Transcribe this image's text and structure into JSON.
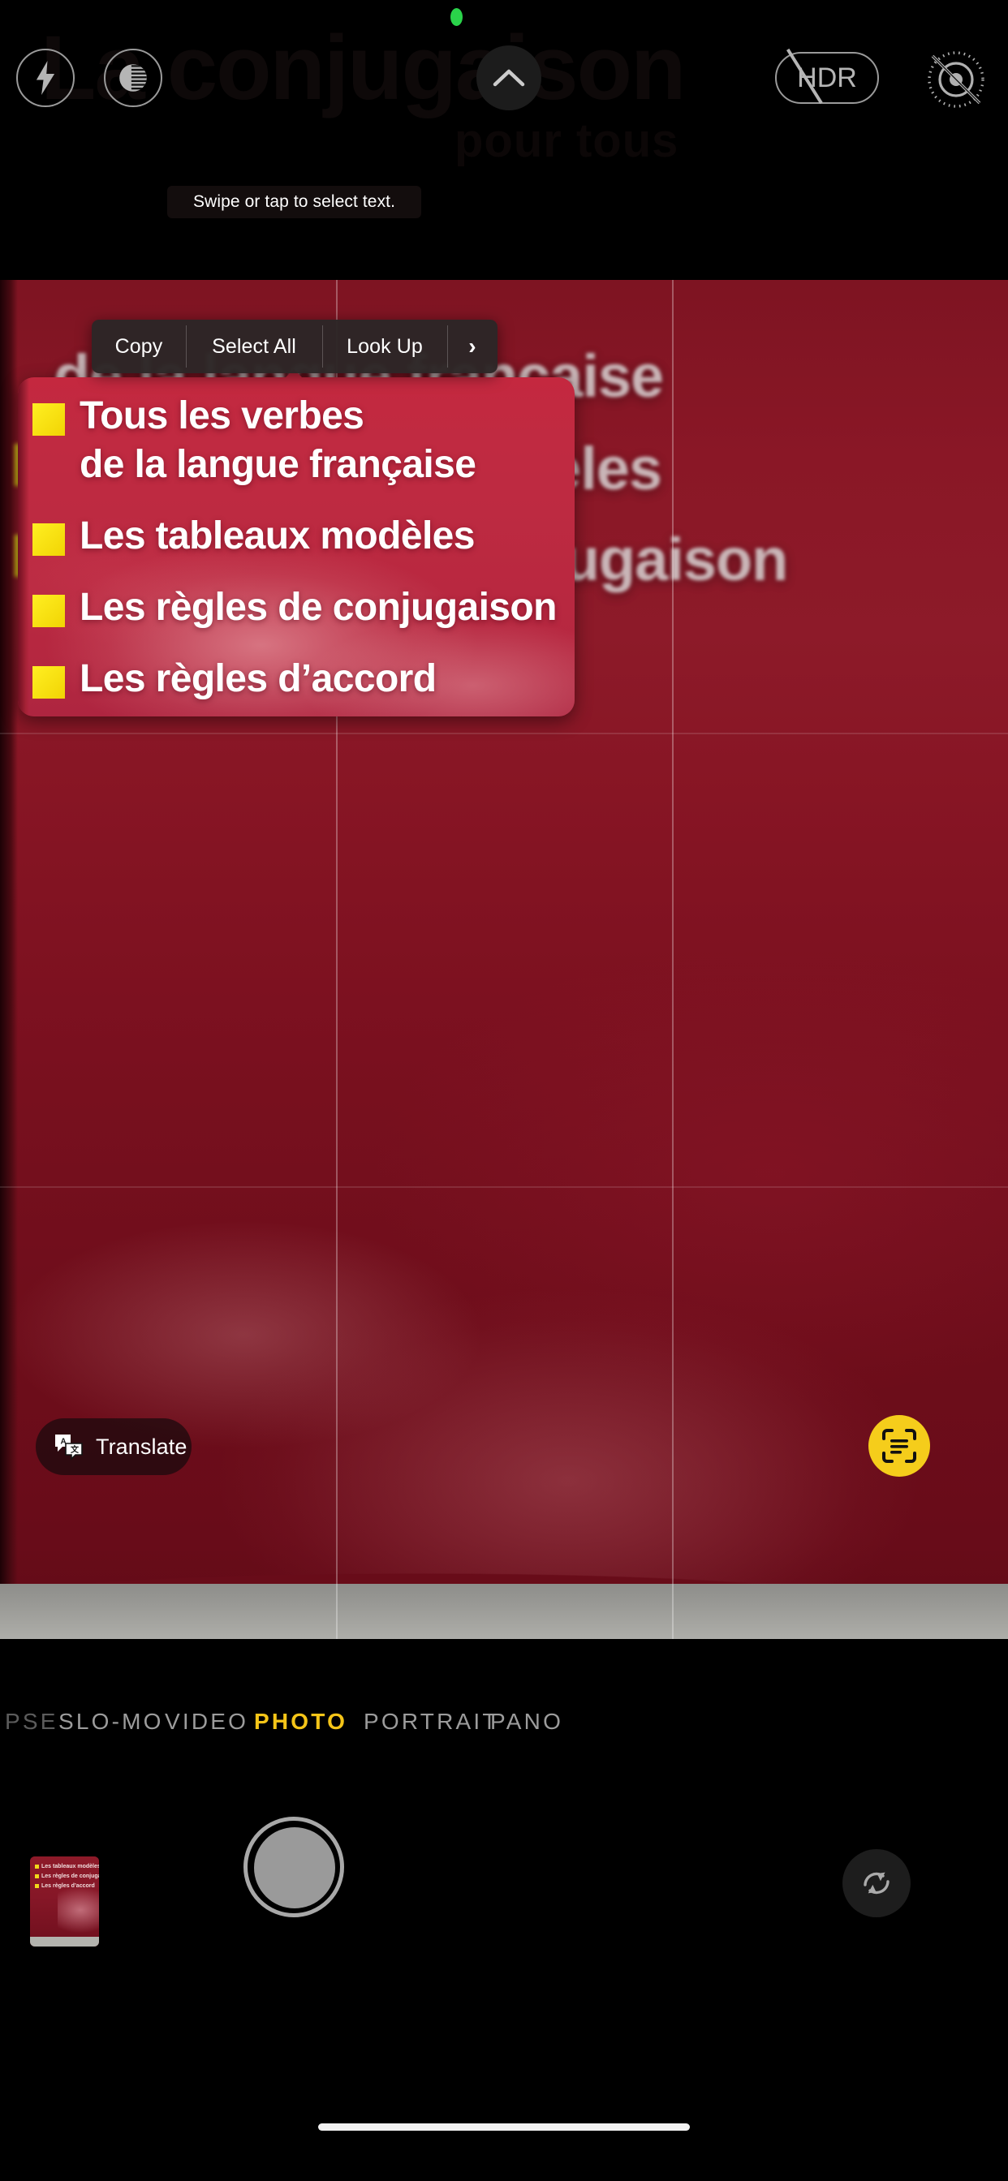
{
  "app": {
    "name": "Camera",
    "mode_active": "PHOTO"
  },
  "ghost": {
    "title": "La conjugaison",
    "subtitle": "pour tous"
  },
  "top_controls": {
    "flash_icon": "flash-icon",
    "night_mode_icon": "night-mode-icon",
    "chevron_icon": "chevron-up-icon",
    "hdr_label": "HDR",
    "hdr_state": "off",
    "live_photo_icon": "live-photo-off-icon",
    "recording_dot_color": "#2ad34a"
  },
  "live_text": {
    "tooltip": "Swipe or tap to select text.",
    "context_menu": [
      {
        "label": "Copy",
        "name": "copy"
      },
      {
        "label": "Select All",
        "name": "select-all"
      },
      {
        "label": "Look Up",
        "name": "look-up"
      },
      {
        "label": "›",
        "name": "more"
      }
    ]
  },
  "book_cover": {
    "bullet_color": "#f2d614",
    "cover_color": "#8a1726",
    "lines": [
      "Tous les verbes",
      "de la langue française",
      "Les tableaux modèles",
      "Les règles de conjugaison",
      "Les règles d’accord"
    ],
    "loupe_lines": [
      {
        "bullet": true,
        "text": "Tous les verbes"
      },
      {
        "bullet": false,
        "text": "de la langue française"
      },
      {
        "bullet": true,
        "text": "Les tableaux modèles"
      },
      {
        "bullet": true,
        "text": "Les règles de conjugaison"
      },
      {
        "bullet": true,
        "text": "Les règles d’accord"
      }
    ]
  },
  "actions": {
    "translate_label": "Translate",
    "translate_icon": "translate-icon",
    "scan_icon": "live-text-scan-icon",
    "scan_button_color": "#f5cd1b"
  },
  "modes": [
    {
      "label": "PSE",
      "selected": false
    },
    {
      "label": "SLO-MO",
      "selected": false
    },
    {
      "label": "VIDEO",
      "selected": false
    },
    {
      "label": "PHOTO",
      "selected": true
    },
    {
      "label": "PORTRAIT",
      "selected": false
    },
    {
      "label": "PANO",
      "selected": false
    }
  ],
  "selected_mode_color": "#f5c518",
  "bottom_bar": {
    "thumbnail_lines": [
      "Les tableaux modèles",
      "Les règles de conjugaison",
      "Les règles d’accord"
    ],
    "shutter_name": "shutter-button",
    "flip_icon": "camera-flip-icon"
  }
}
